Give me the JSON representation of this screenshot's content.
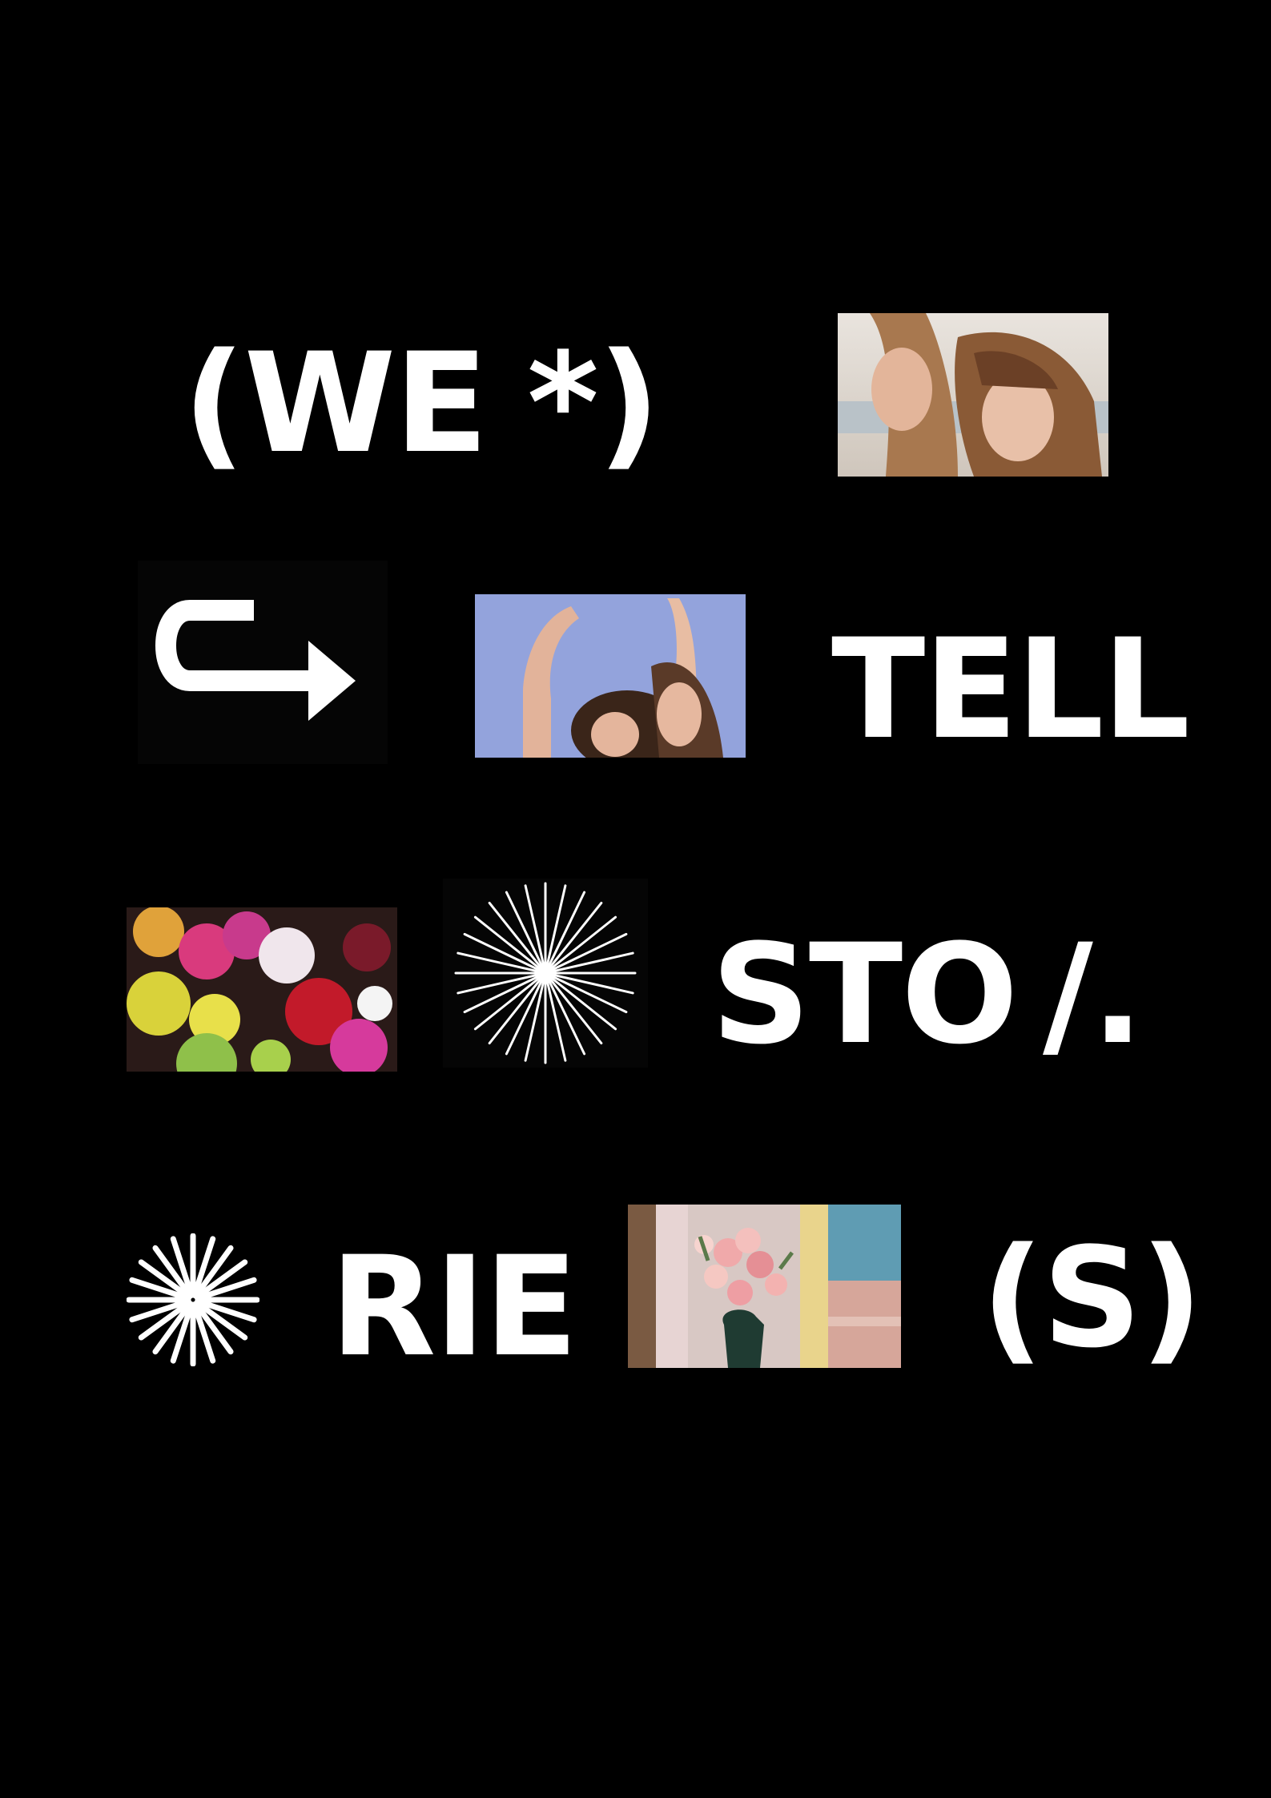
{
  "row1": {
    "word_left": "(WE",
    "word_right": "*)"
  },
  "row2": {
    "word": "TELL"
  },
  "row3": {
    "word_left": "STO",
    "word_right": "/."
  },
  "row4": {
    "word_left": "RIE",
    "word_right": "(S)"
  },
  "icons": {
    "arrow": "curved-arrow-icon",
    "burst_fine": "starburst-icon",
    "burst_bold": "sunburst-icon"
  },
  "photos": {
    "p1": "two-women-cheek-photo",
    "p2": "women-arms-raised-photo",
    "p3": "flower-market-photo",
    "p4": "flower-vase-painting"
  },
  "colors": {
    "background": "#000000",
    "text": "#ffffff"
  }
}
